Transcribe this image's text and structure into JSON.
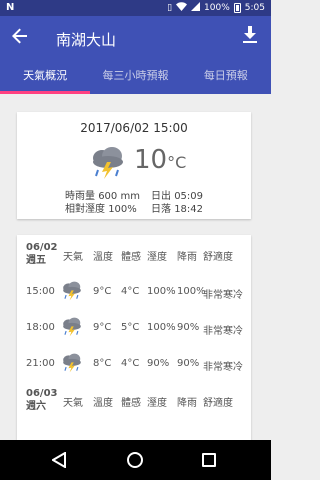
{
  "status_bar": {
    "left_icon": "N",
    "battery": "100%",
    "time": "5:05",
    "icons": [
      "vibrate-icon",
      "wifi-icon",
      "signal-icon",
      "battery-icon"
    ]
  },
  "app_bar": {
    "title": "南湖大山",
    "back_icon": "arrow-back-icon",
    "download_icon": "download-icon"
  },
  "tabs": [
    {
      "label": "天氣概況",
      "active": true
    },
    {
      "label": "每三小時預報",
      "active": false
    },
    {
      "label": "每日預報",
      "active": false
    }
  ],
  "current": {
    "datetime": "2017/06/02 15:00",
    "weather_icon": "cloud-lightning-rain-icon",
    "temperature": "10",
    "unit": "°C",
    "rain_label": "時雨量",
    "rain_value": "600",
    "rain_unit": "mm",
    "sunrise_label": "日出",
    "sunrise": "05:09",
    "humidity_label": "相對溼度",
    "humidity": "100%",
    "sunset_label": "日落",
    "sunset": "18:42"
  },
  "table": {
    "headers": [
      "天氣",
      "溫度",
      "體感",
      "溼度",
      "降雨",
      "舒適度"
    ],
    "day1": {
      "date": "06/02",
      "weekday": "週五"
    },
    "rows": [
      {
        "time": "15:00",
        "temp": "9°C",
        "feel": "4°C",
        "hum": "100%",
        "rain": "100%",
        "comfort": "非常寒冷"
      },
      {
        "time": "18:00",
        "temp": "9°C",
        "feel": "5°C",
        "hum": "100%",
        "rain": "90%",
        "comfort": "非常寒冷"
      },
      {
        "time": "21:00",
        "temp": "8°C",
        "feel": "4°C",
        "hum": "90%",
        "rain": "90%",
        "comfort": "非常寒冷"
      }
    ],
    "day2": {
      "date": "06/03",
      "weekday": "週六"
    }
  },
  "colors": {
    "primary": "#3f51b5",
    "status": "#2e3a86",
    "accent": "#ff4081"
  }
}
